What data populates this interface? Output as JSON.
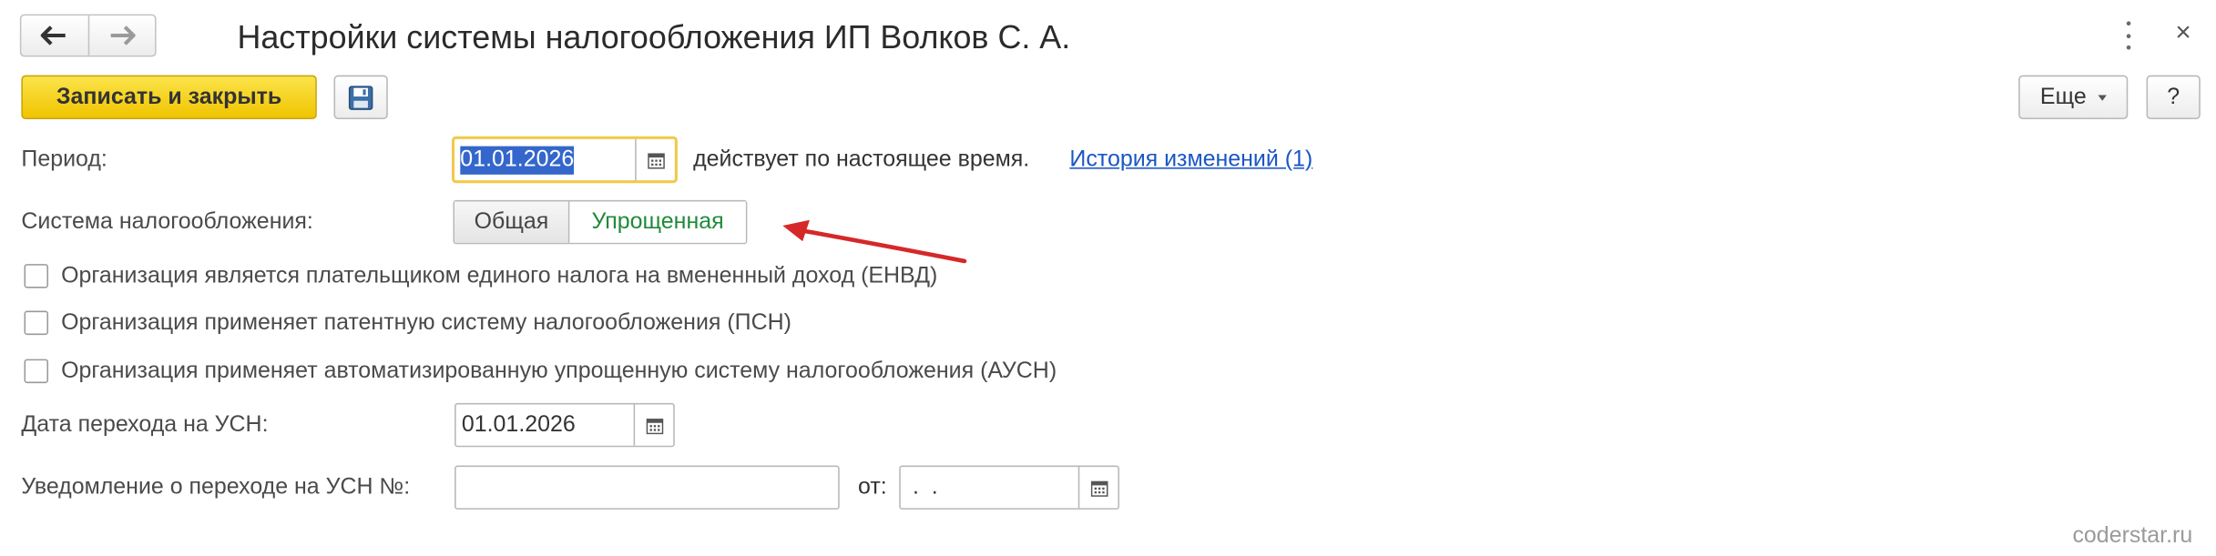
{
  "window": {
    "title": "Настройки системы налогообложения ИП Волков С. А."
  },
  "toolbar": {
    "save_close_label": "Записать и закрыть",
    "more_label": "Еще",
    "help_label": "?"
  },
  "form": {
    "period": {
      "label": "Период:",
      "value": "01.01.2026",
      "status_text": "действует по настоящее время.",
      "history_link": "История изменений (1)"
    },
    "tax_system": {
      "label": "Система налогообложения:",
      "options": [
        "Общая",
        "Упрощенная"
      ],
      "selected": "Упрощенная"
    },
    "checkboxes": [
      {
        "label": "Организация является плательщиком единого налога на вмененный доход (ЕНВД)",
        "checked": false
      },
      {
        "label": "Организация применяет патентную систему налогообложения (ПСН)",
        "checked": false
      },
      {
        "label": "Организация применяет автоматизированную упрощенную систему налогообложения (АУСН)",
        "checked": false
      }
    ],
    "usn_date": {
      "label": "Дата перехода на УСН:",
      "value": "01.01.2026"
    },
    "notification": {
      "label": "Уведомление о переходе на УСН №:",
      "number_value": "",
      "from_label": "от:",
      "date_value": " .  ."
    }
  },
  "watermark": "coderstar.ru",
  "colors": {
    "primary_button": "#f5cf1a",
    "link": "#1a56c4",
    "selected_option": "#1f8a3a",
    "annotation_arrow": "#d62828",
    "focus_border": "#f2c94c"
  }
}
